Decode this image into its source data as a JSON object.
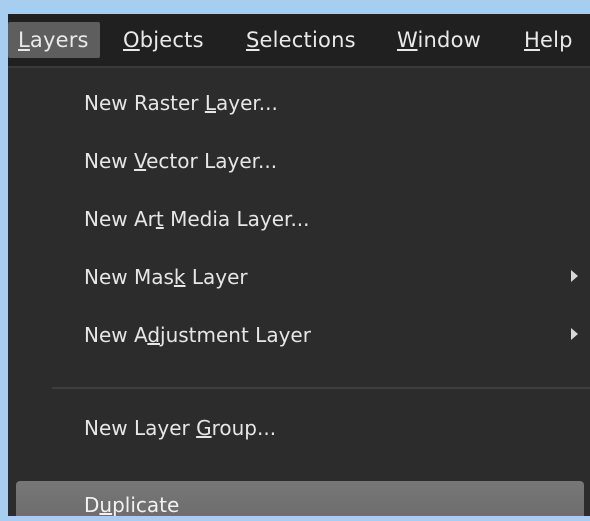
{
  "menubar": {
    "items": [
      {
        "pre": "",
        "ul": "L",
        "post": "ayers"
      },
      {
        "pre": "",
        "ul": "O",
        "post": "bjects"
      },
      {
        "pre": "",
        "ul": "S",
        "post": "elections"
      },
      {
        "pre": "",
        "ul": "W",
        "post": "indow"
      },
      {
        "pre": "",
        "ul": "H",
        "post": "elp"
      }
    ]
  },
  "dropdown": {
    "items": [
      {
        "pre": "New Raster ",
        "ul": "L",
        "post": "ayer..."
      },
      {
        "pre": "New ",
        "ul": "V",
        "post": "ector Layer..."
      },
      {
        "pre": "New Ar",
        "ul": "t",
        "post": " Media Layer..."
      },
      {
        "pre": "New Mas",
        "ul": "k",
        "post": " Layer"
      },
      {
        "pre": "New A",
        "ul": "d",
        "post": "justment Layer"
      },
      {
        "pre": "New Layer ",
        "ul": "G",
        "post": "roup..."
      },
      {
        "pre": "D",
        "ul": "u",
        "post": "plicate"
      }
    ]
  }
}
